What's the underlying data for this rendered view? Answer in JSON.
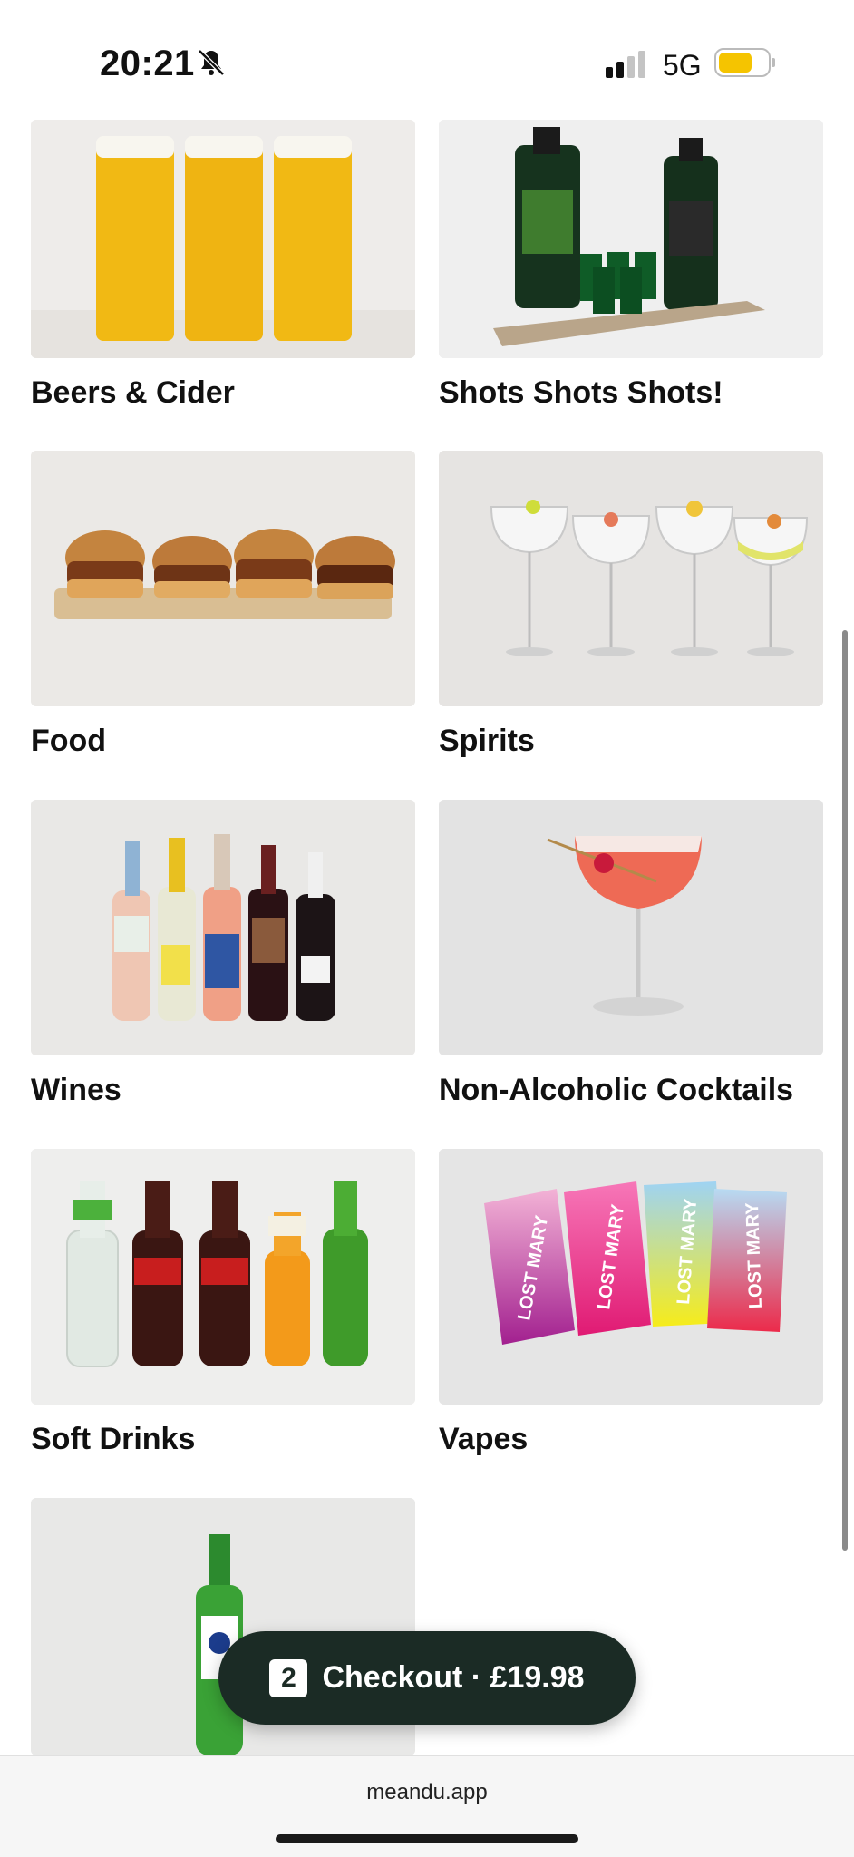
{
  "status_bar": {
    "time": "20:21",
    "network": "5G",
    "battery_color": "#f5c400"
  },
  "categories": [
    {
      "label": "Beers & Cider",
      "image": "beer-glasses-image"
    },
    {
      "label": "Shots Shots Shots!",
      "image": "shots-bottles-image"
    },
    {
      "label": "Food",
      "image": "burgers-image"
    },
    {
      "label": "Spirits",
      "image": "gin-glasses-image"
    },
    {
      "label": "Wines",
      "image": "wine-bottles-image"
    },
    {
      "label": "Non-Alcoholic Cocktails",
      "image": "mocktail-image"
    },
    {
      "label": "Soft Drinks",
      "image": "soft-drink-bottles-image"
    },
    {
      "label": "Vapes",
      "image": "vape-devices-image"
    },
    {
      "label": "",
      "image": "beer-bottle-image"
    }
  ],
  "vape_brand": "LOST MARY",
  "checkout": {
    "count": "2",
    "label": "Checkout · £19.98",
    "bg_color": "#1b2b25"
  },
  "browser": {
    "url": "meandu.app"
  }
}
